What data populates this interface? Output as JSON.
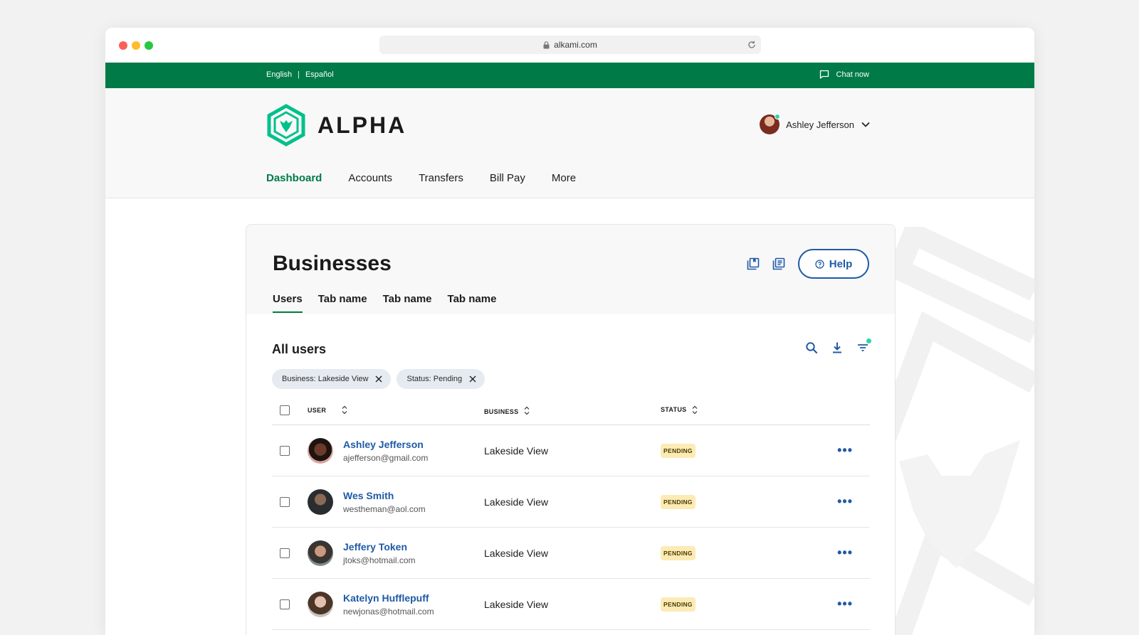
{
  "browser": {
    "url": "alkami.com"
  },
  "topbar": {
    "languages": [
      "English",
      "Español"
    ],
    "separator": "|",
    "chat_label": "Chat now"
  },
  "brand": {
    "name": "ALPHA",
    "accent": "#00c08b",
    "primary": "#007a46"
  },
  "user": {
    "name": "Ashley Jefferson"
  },
  "nav": [
    {
      "label": "Dashboard",
      "active": true
    },
    {
      "label": "Accounts"
    },
    {
      "label": "Transfers"
    },
    {
      "label": "Bill Pay"
    },
    {
      "label": "More"
    }
  ],
  "page": {
    "title": "Businesses",
    "help_label": "Help",
    "tabs": [
      {
        "label": "Users",
        "active": true
      },
      {
        "label": "Tab name"
      },
      {
        "label": "Tab name"
      },
      {
        "label": "Tab name"
      }
    ]
  },
  "section": {
    "title": "All users",
    "filters": [
      "Business: Lakeside View",
      "Status: Pending"
    ]
  },
  "table": {
    "columns": [
      "USER",
      "BUSINESS",
      "STATUS"
    ],
    "rows": [
      {
        "name": "Ashley Jefferson",
        "email": "ajefferson@gmail.com",
        "business": "Lakeside View",
        "status": "PENDING"
      },
      {
        "name": "Wes Smith",
        "email": "westheman@aol.com",
        "business": "Lakeside View",
        "status": "PENDING"
      },
      {
        "name": "Jeffery Token",
        "email": "jtoks@hotmail.com",
        "business": "Lakeside View",
        "status": "PENDING"
      },
      {
        "name": "Katelyn Hufflepuff",
        "email": "newjonas@hotmail.com",
        "business": "Lakeside View",
        "status": "PENDING"
      }
    ]
  }
}
